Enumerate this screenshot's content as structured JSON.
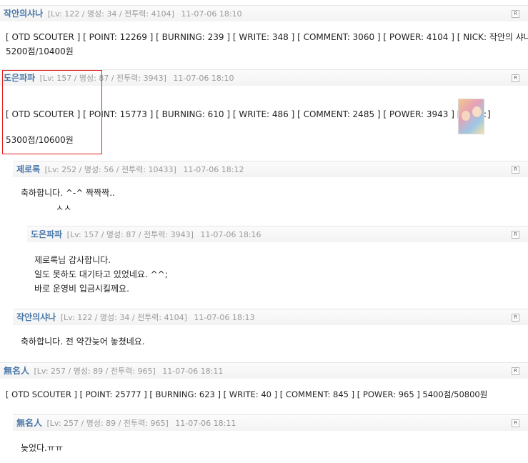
{
  "reply_label": "R",
  "comments": [
    {
      "nick": "작안의샤나",
      "meta": "[Lv: 122 / 명성: 34 / 전투력: 4104]",
      "date": "11-07-06 18:10",
      "lines": [
        "[ OTD SCOUTER ] [ POINT: 12269 ] [ BURNING: 239 ] [ WRITE: 348 ] [ COMMENT: 3060 ] [ POWER: 4104 ] [ NICK: 작안의 샤나 ]",
        "5200점/10400원"
      ]
    },
    {
      "nick": "도은파파",
      "meta": "[Lv: 157 / 명성: 87 / 전투력: 3943]",
      "date": "11-07-06 18:10",
      "lines": [
        "[ OTD SCOUTER ] [ POINT: 15773 ] [ BURNING: 610 ] [ WRITE: 486 ] [ COMMENT: 2485 ] [ POWER: 3943 ] [ NICK:",
        "]",
        "5300점/10600원"
      ]
    },
    {
      "nick": "제로록",
      "meta": "[Lv: 252 / 명성: 56 / 전투력: 10433]",
      "date": "11-07-06 18:12",
      "lines": [
        "축하합니다. ^-^ 짝짝짝..",
        "ㅅㅅ"
      ]
    },
    {
      "nick": "도은파파",
      "meta": "[Lv: 157 / 명성: 87 / 전투력: 3943]",
      "date": "11-07-06 18:16",
      "lines": [
        "제로록님 감사합니다.",
        "일도 못하도 대기타고 있었네요. ^^;",
        "바로 운영비 입금시킬께요."
      ]
    },
    {
      "nick": "작안의샤나",
      "meta": "[Lv: 122 / 명성: 34 / 전투력: 4104]",
      "date": "11-07-06 18:13",
      "lines": [
        "축하합니다. 전 약간늦어 놓쳤네요."
      ]
    },
    {
      "nick": "無名人",
      "meta": "[Lv: 257 / 명성: 89 / 전투력: 965]",
      "date": "11-07-06 18:11",
      "lines": [
        "[ OTD SCOUTER ] [ POINT: 25777 ] [ BURNING: 623 ] [ WRITE: 40 ] [ COMMENT: 845 ] [ POWER: 965 ] 5400점/50800원"
      ]
    },
    {
      "nick": "無名人",
      "meta": "[Lv: 257 / 명성: 89 / 전투력: 965]",
      "date": "11-07-06 18:11",
      "lines": [
        "늦었다.ㅠㅠ"
      ]
    }
  ]
}
